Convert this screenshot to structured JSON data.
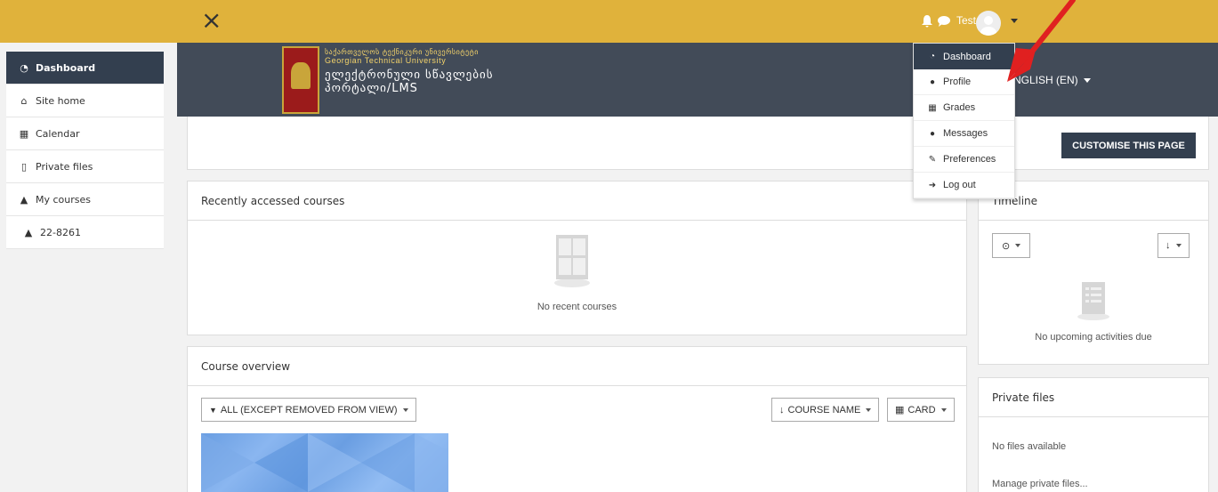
{
  "topbar": {
    "close_glyph": "×",
    "user_name": "Test",
    "colors": {
      "bar": "#e0b23b"
    }
  },
  "icons": [
    "close-icon",
    "bell-icon",
    "chat-icon",
    "avatar",
    "dashboard-icon",
    "home-icon",
    "calendar-icon",
    "file-icon",
    "graduation-cap-icon",
    "user-icon",
    "grid-icon",
    "wrench-icon",
    "logout-icon",
    "filter-icon",
    "sort-icon",
    "clock-icon"
  ],
  "sidebar": {
    "items": [
      {
        "label": "Dashboard",
        "icon": "dashboard-icon"
      },
      {
        "label": "Site home",
        "icon": "home-icon"
      },
      {
        "label": "Calendar",
        "icon": "calendar-icon"
      },
      {
        "label": "Private files",
        "icon": "file-icon"
      },
      {
        "label": "My courses",
        "icon": "graduation-cap-icon"
      },
      {
        "label": "22-8261",
        "icon": "graduation-cap-icon"
      }
    ]
  },
  "banner": {
    "line1": "საქართველოს ტექნიკური უნივერსიტეტი",
    "line2": "Georgian Technical University",
    "line3": "ელექტრონული სწავლების",
    "line4": "პორტალი/LMS",
    "language": "ENGLISH (EN)"
  },
  "user_menu": {
    "items": [
      {
        "label": "Dashboard",
        "icon": "dashboard-icon"
      },
      {
        "label": "Profile",
        "icon": "user-icon"
      },
      {
        "label": "Grades",
        "icon": "grid-icon"
      },
      {
        "label": "Messages",
        "icon": "chat-icon"
      },
      {
        "label": "Preferences",
        "icon": "wrench-icon"
      },
      {
        "label": "Log out",
        "icon": "logout-icon"
      }
    ]
  },
  "page": {
    "customise_label": "CUSTOMISE THIS PAGE"
  },
  "recent": {
    "title": "Recently accessed courses",
    "empty": "No recent courses"
  },
  "overview": {
    "title": "Course overview",
    "filter_label": "ALL (EXCEPT REMOVED FROM VIEW)",
    "sort_label": "COURSE NAME",
    "view_label": "CARD"
  },
  "timeline": {
    "title": "Timeline",
    "empty": "No upcoming activities due"
  },
  "private_files": {
    "title": "Private files",
    "empty": "No files available",
    "manage": "Manage private files..."
  },
  "annotation": {
    "arrow_color": "#e02020"
  }
}
